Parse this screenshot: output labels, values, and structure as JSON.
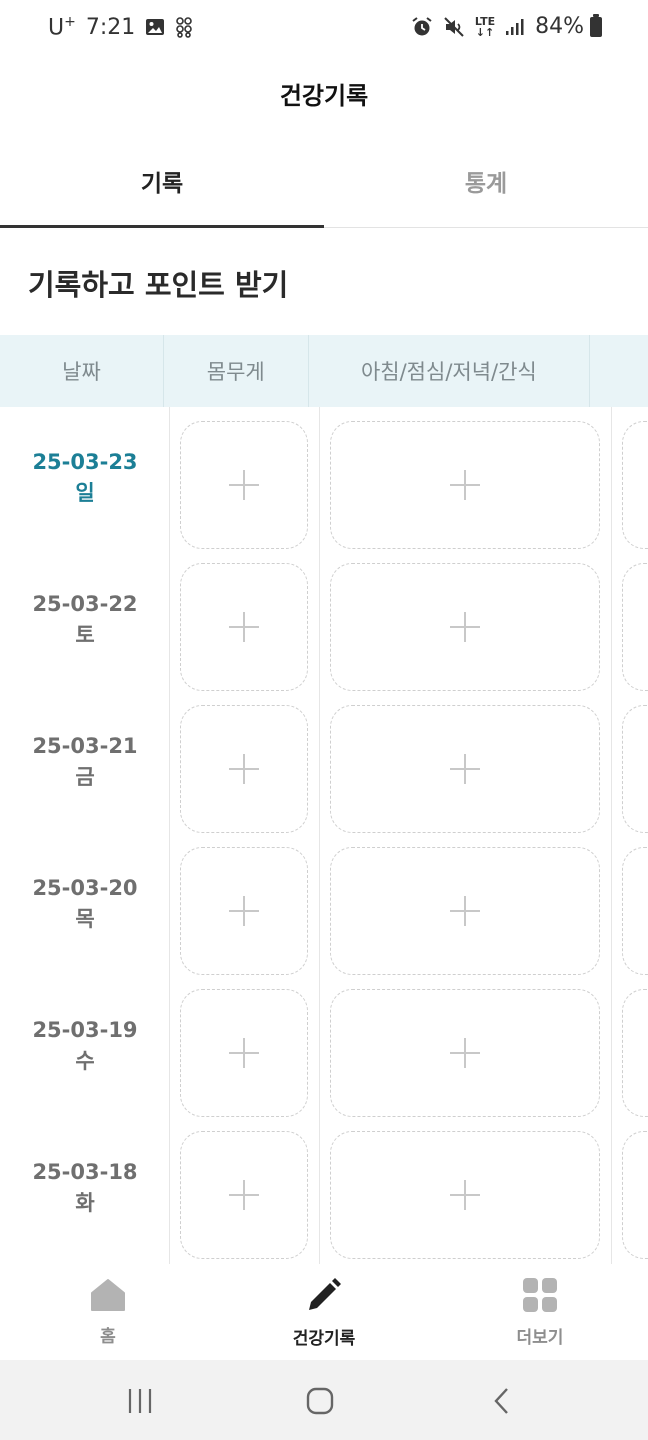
{
  "status_bar": {
    "carrier": "U",
    "carrier_sup": "+",
    "time": "7:21",
    "battery": "84%",
    "network": "LTE"
  },
  "header": {
    "title": "건강기록"
  },
  "tabs": [
    {
      "label": "기록",
      "active": true
    },
    {
      "label": "통계",
      "active": false
    }
  ],
  "section": {
    "title": "기록하고 포인트 받기"
  },
  "table": {
    "headers": [
      "날짜",
      "몸무게",
      "아침/점심/저녁/간식"
    ],
    "rows": [
      {
        "date": "25-03-23",
        "day": "일",
        "today": true
      },
      {
        "date": "25-03-22",
        "day": "토",
        "today": false
      },
      {
        "date": "25-03-21",
        "day": "금",
        "today": false
      },
      {
        "date": "25-03-20",
        "day": "목",
        "today": false
      },
      {
        "date": "25-03-19",
        "day": "수",
        "today": false
      },
      {
        "date": "25-03-18",
        "day": "화",
        "today": false
      }
    ]
  },
  "bottom_nav": [
    {
      "label": "홈",
      "icon": "home-icon",
      "active": false
    },
    {
      "label": "건강기록",
      "icon": "pencil-icon",
      "active": true
    },
    {
      "label": "더보기",
      "icon": "grid-icon",
      "active": false
    }
  ],
  "colors": {
    "accent": "#1c7f96",
    "header_bg": "#e9f4f7",
    "inactive": "#8e8e8e"
  }
}
